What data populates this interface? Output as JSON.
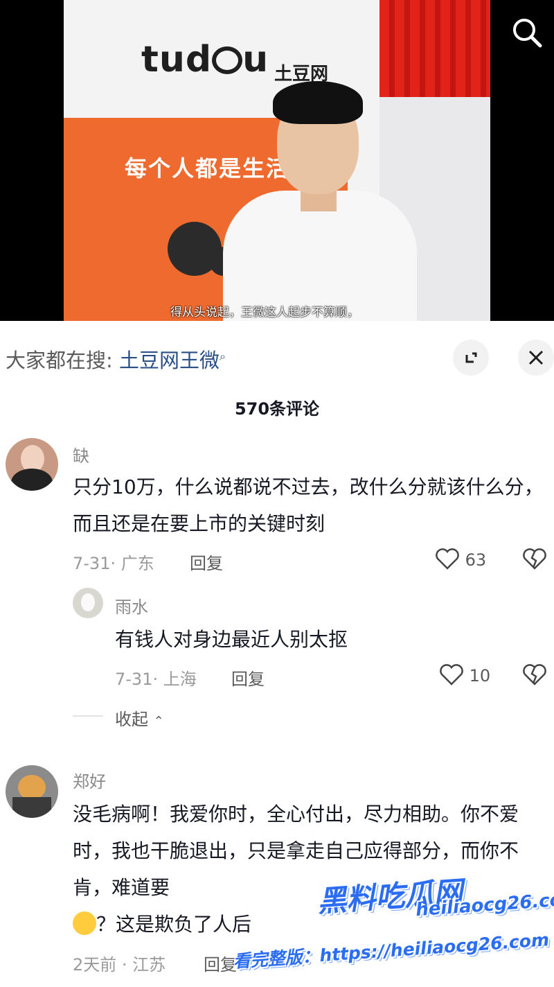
{
  "video": {
    "logo_text": "tud",
    "logo_tail": "u",
    "logo_cn": "土豆网",
    "slogan": "每个人都是生活",
    "subtitle": "得从头说起，王微这人起步不算顺，"
  },
  "header": {
    "hot_prefix": "大家都在搜:",
    "hot_keyword": "土豆网王微",
    "comment_count": "570条评论"
  },
  "comments": [
    {
      "user": "缺",
      "text": "只分10万，什么说都说不过去，改什么分就该什么分，而且还是在要上市的关键时刻",
      "meta": "7-31· 广东",
      "reply_label": "回复",
      "likes": "63"
    },
    {
      "user": "雨水",
      "text": "有钱人对身边最近人别太抠",
      "meta": "7-31· 上海",
      "reply_label": "回复",
      "likes": "10"
    },
    {
      "user": "郑好",
      "text": "没毛病啊！我爱你时，全心付出，尽力相助。你不爱时，我也干脆退出，只是拿走自己应得部分，而你不肯，难道要",
      "text2": "？这是欺负了人后",
      "meta": "2天前 · 江苏",
      "reply_label": "回复"
    }
  ],
  "collapse_label": "收起",
  "watermark": {
    "site": "黑料吃瓜网",
    "url": "heiliaocg26.com",
    "bottom": "看完整版：https://heiliaocg26.com"
  },
  "colors": {
    "accent_link": "#2a4e86",
    "watermark": "#2b6df2"
  }
}
